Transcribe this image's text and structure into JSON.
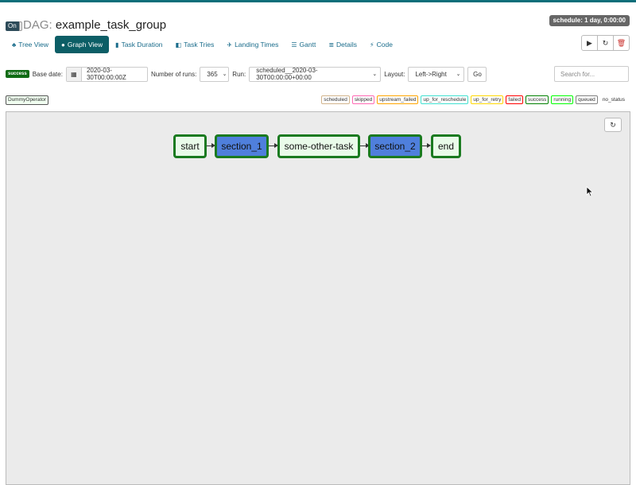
{
  "header": {
    "toggle_label": "On",
    "dag_prefix": "DAG:",
    "dag_id": "example_task_group",
    "schedule": "schedule: 1 day, 0:00:00"
  },
  "tabs": [
    {
      "label": "Tree View",
      "icon": "tree-icon",
      "active": false
    },
    {
      "label": "Graph View",
      "icon": "circle-icon",
      "active": true
    },
    {
      "label": "Task Duration",
      "icon": "bar-chart-icon",
      "active": false
    },
    {
      "label": "Task Tries",
      "icon": "tries-icon",
      "active": false
    },
    {
      "label": "Landing Times",
      "icon": "plane-icon",
      "active": false
    },
    {
      "label": "Gantt",
      "icon": "gantt-icon",
      "active": false
    },
    {
      "label": "Details",
      "icon": "list-icon",
      "active": false
    },
    {
      "label": "Code",
      "icon": "bolt-icon",
      "active": false
    }
  ],
  "actions": {
    "trigger_icon": "play-icon",
    "refresh_icon": "refresh-icon",
    "delete_icon": "trash-icon"
  },
  "filters": {
    "status_badge": "success",
    "base_date_label": "Base date:",
    "base_date_value": "2020-03-30T00:00:00Z",
    "num_runs_label": "Number of runs:",
    "num_runs_value": "365",
    "run_label": "Run:",
    "run_value": "scheduled__2020-03-30T00:00:00+00:00",
    "layout_label": "Layout:",
    "layout_value": "Left->Right",
    "go_label": "Go",
    "search_placeholder": "Search for..."
  },
  "operator_legend": "DummyOperator",
  "state_legend": [
    {
      "label": "scheduled",
      "color": "#d2b48c"
    },
    {
      "label": "skipped",
      "color": "#ff69b4"
    },
    {
      "label": "upstream_failed",
      "color": "#ffa500"
    },
    {
      "label": "up_for_reschedule",
      "color": "#40e0d0"
    },
    {
      "label": "up_for_retry",
      "color": "#ffd700"
    },
    {
      "label": "failed",
      "color": "#ff0000"
    },
    {
      "label": "success",
      "color": "#008000"
    },
    {
      "label": "running",
      "color": "#00ff00"
    },
    {
      "label": "queued",
      "color": "#808080"
    },
    {
      "label": "no_status",
      "color": ""
    }
  ],
  "graph": {
    "nodes": [
      {
        "label": "start",
        "kind": "task"
      },
      {
        "label": "section_1",
        "kind": "group"
      },
      {
        "label": "some-other-task",
        "kind": "task"
      },
      {
        "label": "section_2",
        "kind": "group"
      },
      {
        "label": "end",
        "kind": "task"
      }
    ],
    "colors": {
      "task_fill": "#e9fbe9",
      "group_fill": "#4f7fdc",
      "border": "#1a7a20"
    }
  }
}
